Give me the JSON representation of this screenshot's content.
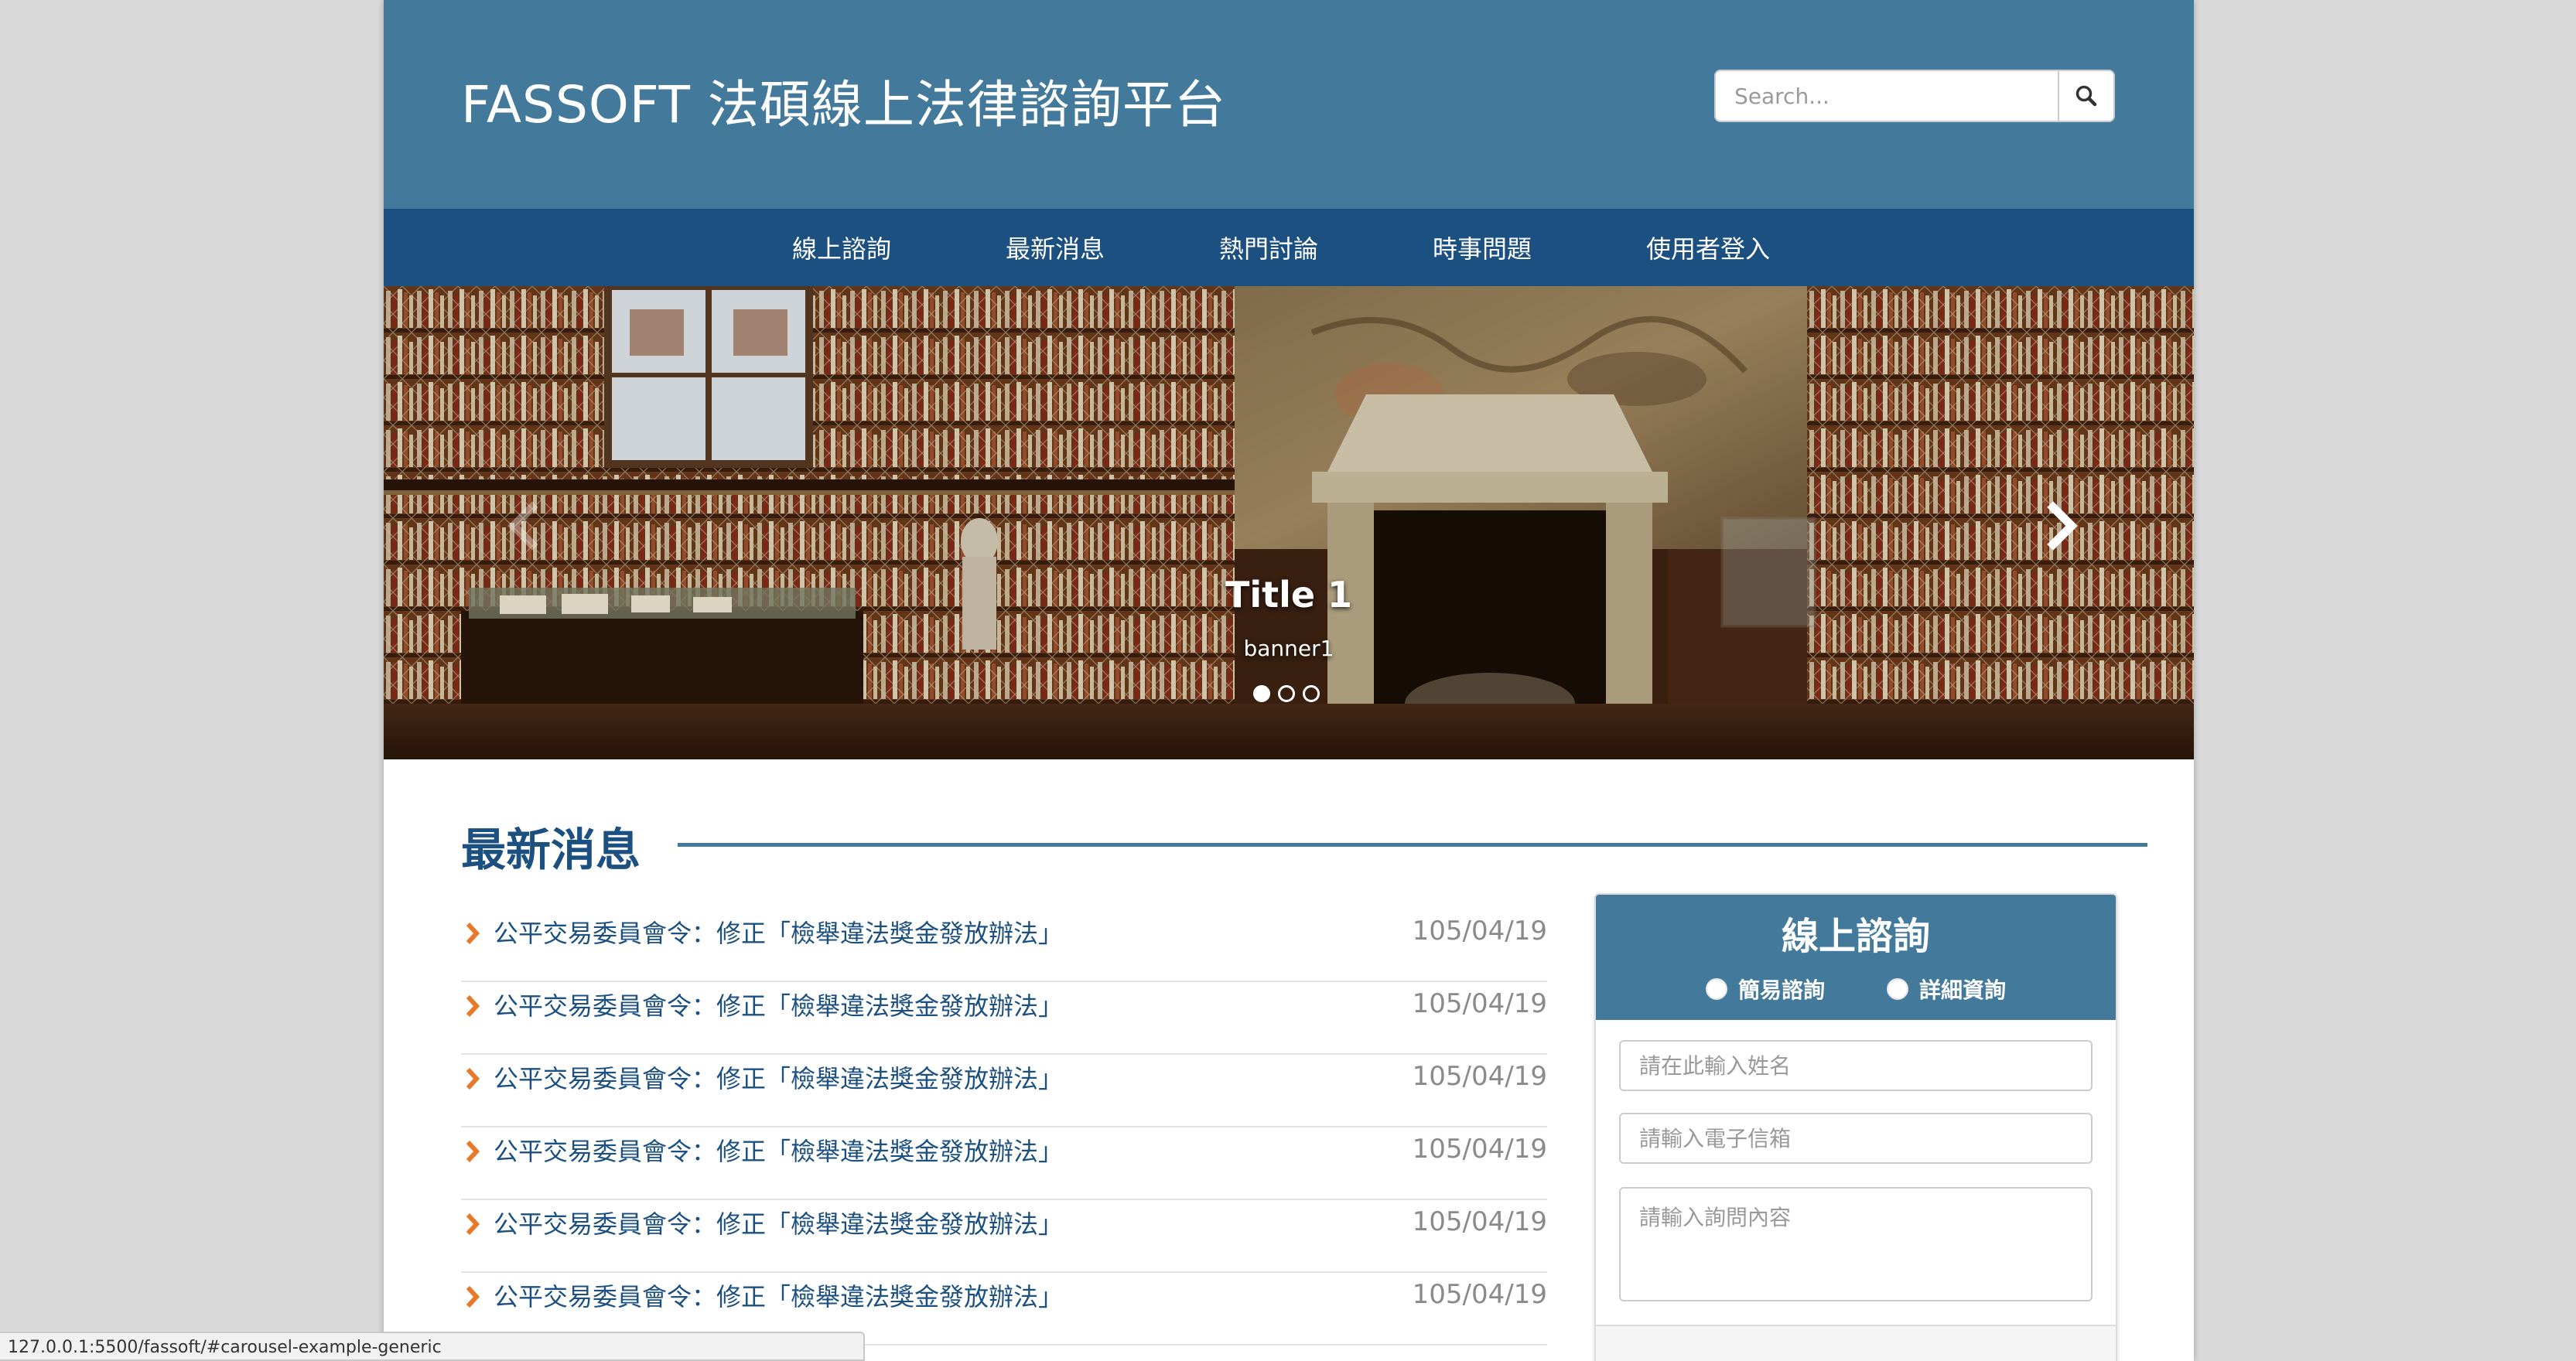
{
  "header": {
    "site_title": "FASSOFT 法碩線上法律諮詢平台",
    "search_placeholder": "Search...",
    "search_icon": "magnifier-icon"
  },
  "nav": {
    "items": [
      "線上諮詢",
      "最新消息",
      "熱門討論",
      "時事問題",
      "使用者登入"
    ]
  },
  "carousel": {
    "caption_title": "Title 1",
    "caption_text": "banner1",
    "slide_count": 3,
    "active_index": 0,
    "prev_icon": "chevron-left-icon",
    "next_icon": "chevron-right-icon"
  },
  "news": {
    "title": "最新消息",
    "items": [
      {
        "title": "公平交易委員會令：修正「檢舉違法獎金發放辦法」",
        "date": "105/04/19"
      },
      {
        "title": "公平交易委員會令：修正「檢舉違法獎金發放辦法」",
        "date": "105/04/19"
      },
      {
        "title": "公平交易委員會令：修正「檢舉違法獎金發放辦法」",
        "date": "105/04/19"
      },
      {
        "title": "公平交易委員會令：修正「檢舉違法獎金發放辦法」",
        "date": "105/04/19"
      },
      {
        "title": "公平交易委員會令：修正「檢舉違法獎金發放辦法」",
        "date": "105/04/19"
      },
      {
        "title": "公平交易委員會令：修正「檢舉違法獎金發放辦法」",
        "date": "105/04/19"
      }
    ]
  },
  "consult": {
    "title": "線上諮詢",
    "options": [
      "簡易諮詢",
      "詳細資詢"
    ],
    "name_placeholder": "請在此輸入姓名",
    "email_placeholder": "請輸入電子信箱",
    "message_placeholder": "請輸入詢問內容"
  },
  "status_bar": {
    "url": "127.0.0.1:5500/fassoft/#carousel-example-generic"
  },
  "colors": {
    "header_bg": "#437a9b",
    "nav_bg": "#1c5080",
    "accent_orange": "#e8792b",
    "link_blue": "#1c5080"
  }
}
